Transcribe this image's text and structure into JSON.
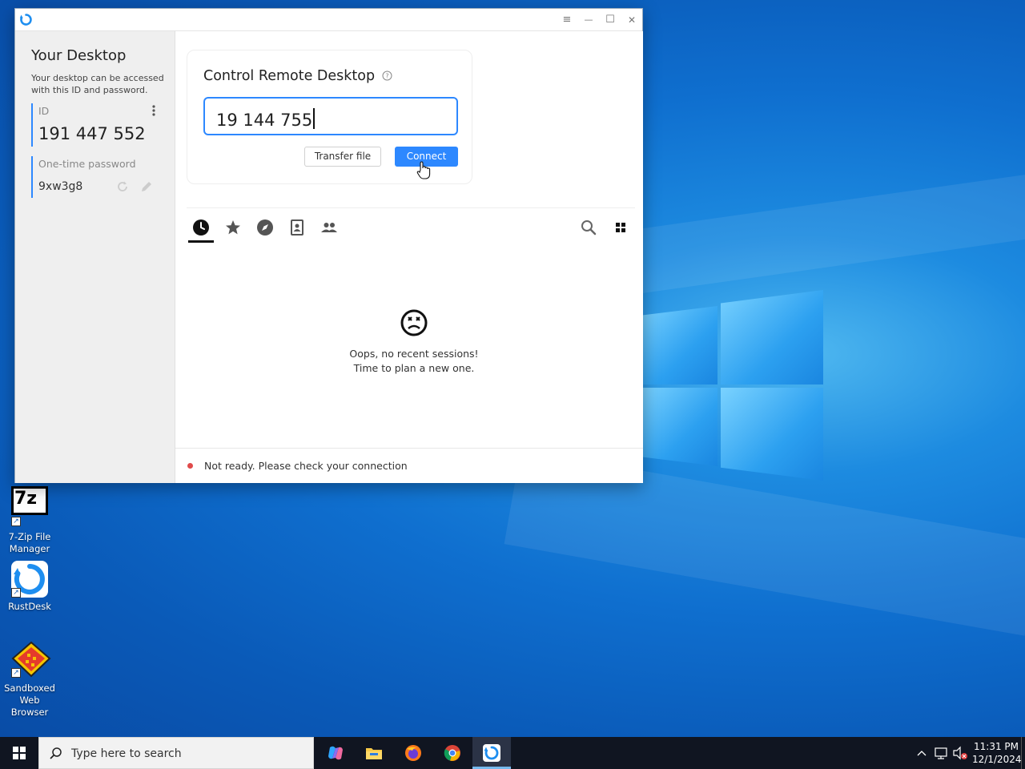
{
  "desktop": {
    "icons": [
      {
        "label": "7-Zip File Manager",
        "line1": "7-Zip File",
        "line2": "Manager",
        "glyph": "7z"
      },
      {
        "label": "RustDesk",
        "line1": "RustDesk",
        "line2": ""
      },
      {
        "label": "Sandboxed Web Browser",
        "line1": "Sandboxed",
        "line2": "Web Browser"
      }
    ]
  },
  "window": {
    "controls": {
      "menu": "≡",
      "minimize": "—",
      "maximize": "☐",
      "close": "✕"
    }
  },
  "sidebar": {
    "title": "Your Desktop",
    "description": "Your desktop can be accessed with this ID and password.",
    "id_label": "ID",
    "id_value": "191 447 552",
    "password_label": "One-time password",
    "password_value": "9xw3g8"
  },
  "connect_card": {
    "title": "Control Remote Desktop",
    "help_icon": "help-circle-icon",
    "input_value": "19 144 755",
    "transfer_button": "Transfer file",
    "connect_button": "Connect"
  },
  "tabs": [
    {
      "icon": "clock-icon",
      "active": true
    },
    {
      "icon": "star-icon"
    },
    {
      "icon": "compass-icon"
    },
    {
      "icon": "address-book-icon"
    },
    {
      "icon": "group-icon"
    }
  ],
  "empty_state": {
    "line1": "Oops, no recent sessions!",
    "line2": "Time to plan a new one."
  },
  "status": {
    "text": "Not ready. Please check your connection",
    "color": "#e04a4a"
  },
  "taskbar": {
    "search_placeholder": "Type here to search",
    "time": "11:31 PM",
    "date": "12/1/2024"
  },
  "colors": {
    "accent": "#2d88ff",
    "taskbar": "#101521"
  }
}
